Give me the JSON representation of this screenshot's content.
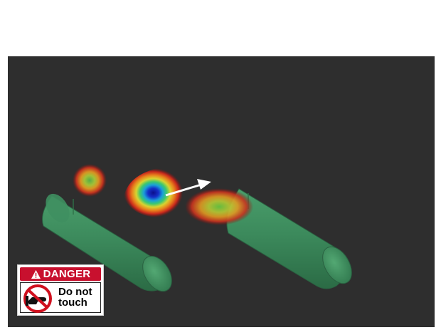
{
  "viewport": {
    "background": "#2e2e2e"
  },
  "scene": {
    "objects": [
      {
        "name": "cylinder-left",
        "color": "#3c8a5c"
      },
      {
        "name": "cylinder-right",
        "color": "#3c8a5c"
      }
    ],
    "heatmaps": [
      {
        "name": "heat-blob-small"
      },
      {
        "name": "heat-blob-center"
      },
      {
        "name": "heat-blob-right"
      }
    ],
    "arrow": {
      "name": "direction-arrow-icon",
      "color": "#ffffff"
    }
  },
  "sign": {
    "header": "DANGER",
    "line1": "Do not",
    "line2": "touch",
    "header_color": "#c8102e",
    "icon": "no-hand-touch-icon"
  }
}
